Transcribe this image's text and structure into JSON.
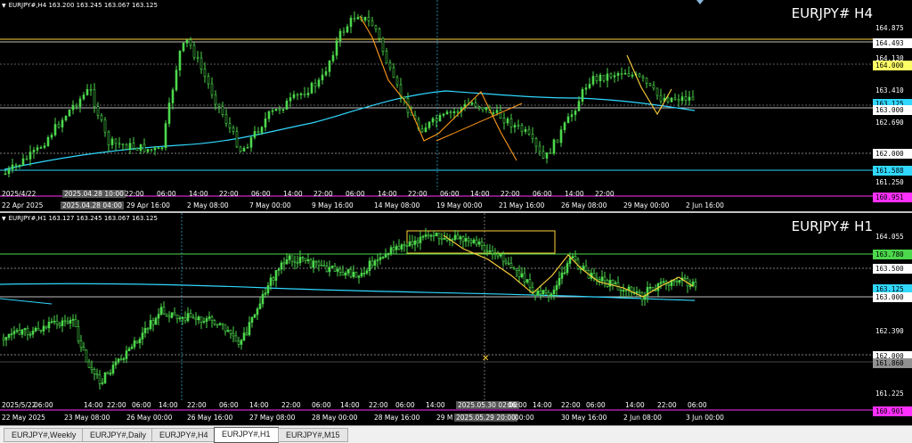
{
  "colors": {
    "bg": "#000000",
    "cyan": "#30d8ff",
    "orange": "#ff9a1a",
    "yellow": "#ffd23a",
    "green": "#4cd84c",
    "magenta": "#ff30ff",
    "gray": "#808080"
  },
  "h4": {
    "header": "EURJPY#,H4  163.200 163.245 163.067 163.125",
    "title": "EURJPY# H4",
    "prices": [
      {
        "text": "164.875",
        "style": "plain"
      },
      {
        "text": "164.493",
        "style": "hl",
        "bg": "#ffffff",
        "fg": "#000000"
      },
      {
        "text": "164.130",
        "style": "plain"
      },
      {
        "text": "164.000",
        "style": "hl",
        "bg": "#ffff66",
        "fg": "#000000"
      },
      {
        "text": "163.410",
        "style": "plain"
      },
      {
        "text": "163.125",
        "style": "hl",
        "bg": "#30d8ff",
        "fg": "#000000"
      },
      {
        "text": "163.000",
        "style": "hl",
        "bg": "#ffffff",
        "fg": "#000000"
      },
      {
        "text": "162.690",
        "style": "plain"
      },
      {
        "text": "162.000",
        "style": "hl",
        "bg": "#ffffff",
        "fg": "#000000"
      },
      {
        "text": "161.588",
        "style": "hl",
        "bg": "#30d8ff",
        "fg": "#000000"
      },
      {
        "text": "161.250",
        "style": "plain"
      },
      {
        "text": "160.951",
        "style": "hl",
        "bg": "#ff30ff",
        "fg": "#000000"
      }
    ],
    "upper_axis": [
      "2025/4/22",
      "2025.04.28 10:00",
      "22:00",
      "06:00",
      "14:00",
      "22:00",
      "06:00",
      "14:00",
      "22:00",
      "06:00",
      "14:00",
      "22:00",
      "06:00",
      "14:00",
      "22:00",
      "06:00",
      "14:00",
      "22:00"
    ],
    "lower_axis": [
      "22 Apr 2025",
      "2025.04.28 04:00",
      "29 Apr 16:00",
      "2 May 08:00",
      "7 May 00:00",
      "9 May 16:00",
      "14 May 08:00",
      "19 May 00:00",
      "21 May 16:00",
      "26 May 08:00",
      "29 May 00:00",
      "2 Jun 16:00"
    ]
  },
  "h1": {
    "header": "EURJPY#,H1  163.127 163.245 163.067 163.125",
    "title": "EURJPY# H1",
    "prices": [
      {
        "text": "164.055",
        "style": "plain"
      },
      {
        "text": "163.780",
        "style": "hl",
        "bg": "#4cd84c",
        "fg": "#000000"
      },
      {
        "text": "163.500",
        "style": "hl",
        "bg": "#ffffff",
        "fg": "#000000"
      },
      {
        "text": "163.125",
        "style": "hl",
        "bg": "#30d8ff",
        "fg": "#000000"
      },
      {
        "text": "163.000",
        "style": "hl",
        "bg": "#ffffff",
        "fg": "#000000"
      },
      {
        "text": "162.390",
        "style": "plain"
      },
      {
        "text": "162.000",
        "style": "hl",
        "bg": "#ffffff",
        "fg": "#000000"
      },
      {
        "text": "161.860",
        "style": "hl",
        "bg": "#909090",
        "fg": "#000000"
      },
      {
        "text": "161.225",
        "style": "plain"
      },
      {
        "text": "160.901",
        "style": "hl",
        "bg": "#ff30ff",
        "fg": "#000000"
      }
    ],
    "upper_axis": [
      "2025/5/22",
      "06:00",
      "14:00",
      "22:00",
      "06:00",
      "14:00",
      "22:00",
      "06:00",
      "14:00",
      "22:00",
      "06:00",
      "14:00",
      "22:00",
      "06:00",
      "14:00",
      "2025.05.30 02:00",
      "06:00",
      "14:00",
      "22:00",
      "06:00",
      "14:00",
      "22:00",
      "06:00"
    ],
    "lower_axis": [
      "22 May 2025",
      "23 May 08:00",
      "26 May 00:00",
      "26 May 16:00",
      "27 May 08:00",
      "28 May 00:00",
      "28 May 16:00",
      "29 M",
      "2025.05.29 20:00",
      "00:00",
      "30 May 16:00",
      "2 Jun 08:00",
      "3 Jun 00:00"
    ]
  },
  "tabs": [
    {
      "label": "EURJPY#,Weekly",
      "active": false
    },
    {
      "label": "EURJPY#,Daily",
      "active": false
    },
    {
      "label": "EURJPY#,H4",
      "active": false
    },
    {
      "label": "EURJPY#,H1",
      "active": true
    },
    {
      "label": "EURJPY#,M15",
      "active": false
    }
  ]
}
